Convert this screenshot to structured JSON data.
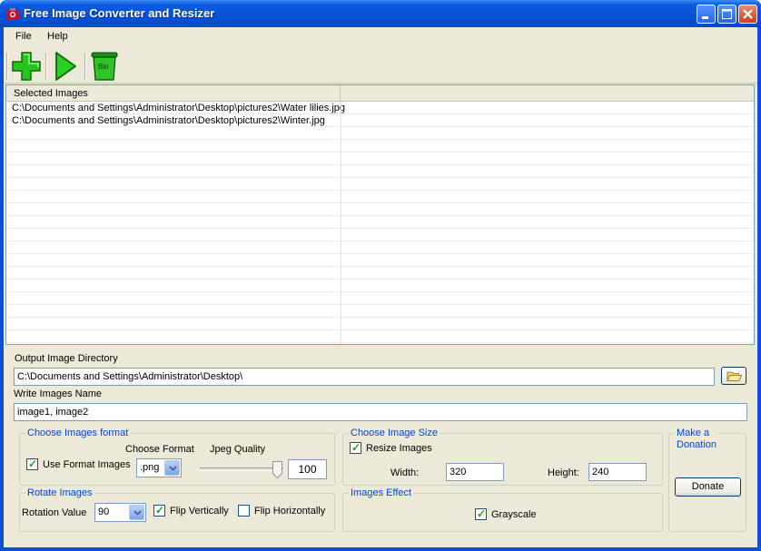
{
  "window": {
    "title": "Free Image Converter and Resizer"
  },
  "menu": {
    "file": "File",
    "help": "Help"
  },
  "toolbar": {
    "add_icon": "add-icon",
    "run_icon": "play-icon",
    "bin_icon": "bin-icon",
    "bin_label": "Bin"
  },
  "list": {
    "header": "Selected Images",
    "items": [
      "C:\\Documents and Settings\\Administrator\\Desktop\\pictures2\\Water lilies.jpg",
      "C:\\Documents and Settings\\Administrator\\Desktop\\pictures2\\Winter.jpg"
    ]
  },
  "output": {
    "dir_label": "Output Image Directory",
    "dir_value": "C:\\Documents and Settings\\Administrator\\Desktop\\",
    "name_label": "Write Images Name",
    "name_value": "image1, image2"
  },
  "format": {
    "group_title": "Choose Images format",
    "use_format_label": "Use Format Images",
    "use_format_checked": true,
    "choose_format_label": "Choose Format",
    "format_value": ".png",
    "quality_label": "Jpeg Quality",
    "quality_value": "100",
    "quality_slider_fraction": 1.0
  },
  "size": {
    "group_title": "Choose Image Size",
    "resize_label": "Resize Images",
    "resize_checked": true,
    "width_label": "Width:",
    "width_value": "320",
    "height_label": "Height:",
    "height_value": "240"
  },
  "rotate": {
    "group_title": "Rotate Images",
    "rotation_label": "Rotation Value",
    "rotation_value": "90",
    "flip_v_label": "Flip Vertically",
    "flip_v_checked": true,
    "flip_h_label": "Flip Horizontally",
    "flip_h_checked": false
  },
  "effect": {
    "group_title": "Images Effect",
    "grayscale_label": "Grayscale",
    "grayscale_checked": true
  },
  "donation": {
    "group_title_line1": "Make a",
    "group_title_line2": "Donation",
    "button_label": "Donate"
  }
}
